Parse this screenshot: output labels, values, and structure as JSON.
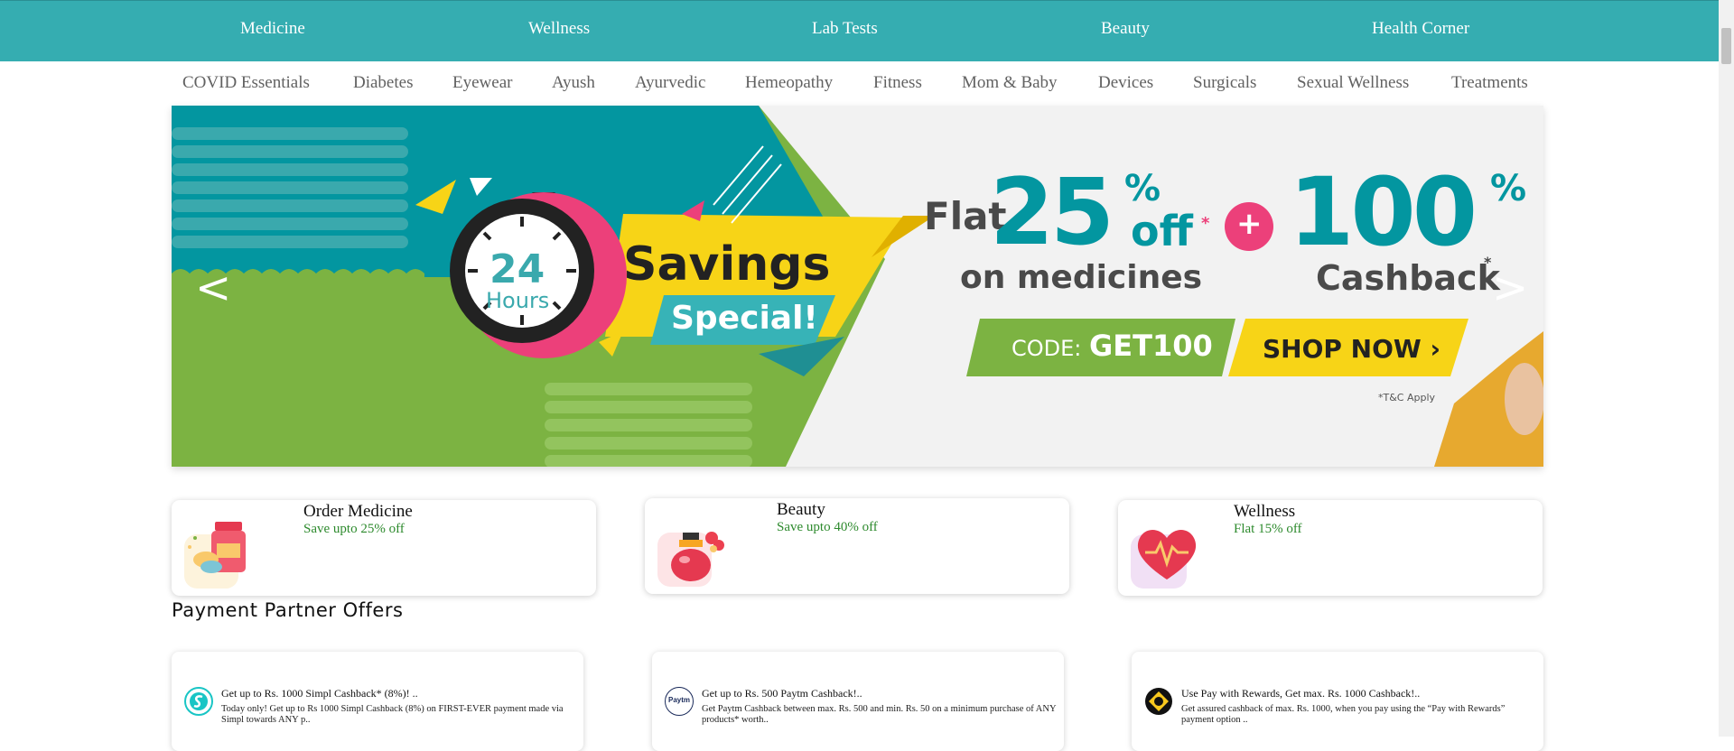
{
  "top_nav": [
    "Medicine",
    "Wellness",
    "Lab Tests",
    "Beauty",
    "Health Corner"
  ],
  "sub_nav": [
    "COVID Essentials",
    "Diabetes",
    "Eyewear",
    "Ayush",
    "Ayurvedic",
    "Hemeopathy",
    "Fitness",
    "Mom & Baby",
    "Devices",
    "Surgicals",
    "Sexual Wellness",
    "Treatments"
  ],
  "banner": {
    "clock_number": "24",
    "clock_unit": "Hours",
    "savings": "Savings",
    "special": "Special!",
    "flat": "Flat",
    "pct": "25",
    "pct_sign": "%",
    "off": "off",
    "asterisk": "*",
    "on_medicines": "on medicines",
    "plus": "+",
    "cashback_pct": "100",
    "cashback": "Cashback",
    "code_label": "CODE:",
    "code": "GET100",
    "shop_now": "SHOP NOW ›",
    "tnc": "*T&C Apply",
    "prev": "<",
    "next": ">"
  },
  "categories": [
    {
      "title": "Order Medicine",
      "subtitle": "Save upto 25% off",
      "icon": "medicine-icon"
    },
    {
      "title": "Beauty",
      "subtitle": "Save upto 40% off",
      "icon": "perfume-icon"
    },
    {
      "title": "Wellness",
      "subtitle": "Flat 15% off",
      "icon": "heart-pulse-icon"
    }
  ],
  "payment_section_title": "Payment Partner Offers",
  "offers": [
    {
      "title": "Get up to Rs. 1000 Simpl Cashback* (8%)! ..",
      "desc": "Today only! Get up to Rs 1000 Simpl Cashback (8%) on FIRST-EVER payment made via Simpl towards ANY p..",
      "logo": "simpl-logo-icon"
    },
    {
      "title": "Get up to Rs. 500 Paytm Cashback!..",
      "desc": "Get Paytm Cashback between max. Rs. 500 and min. Rs. 50 on a minimum purchase of ANY products* worth..",
      "logo": "paytm-logo-icon",
      "logo_text": "Paytm"
    },
    {
      "title": "Use Pay with Rewards, Get max. Rs. 1000 Cashback!..",
      "desc": "Get assured cashback of max. Rs. 1000, when you pay using the “Pay with Rewards” payment option ..",
      "logo": "rewards-logo-icon"
    }
  ],
  "colors": {
    "nav": "#35adb1",
    "teal": "#0396a0",
    "pink": "#ec407a",
    "yellow": "#f7d417",
    "green": "#7cb342",
    "offer_green": "#2d8a2d"
  }
}
